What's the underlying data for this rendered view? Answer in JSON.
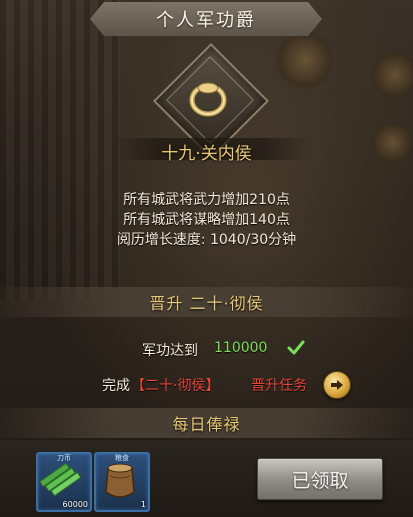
{
  "header": {
    "title": "个人军功爵"
  },
  "rank": {
    "name": "十九·关内侯"
  },
  "bonuses": [
    "所有城武将武力增加210点",
    "所有城武将谋略增加140点",
    "阅历增长速度: 1040/30分钟"
  ],
  "promotion": {
    "header": "晋升 二十·彻侯",
    "merit_label": "军功达到",
    "merit_value": "110000",
    "task_prefix": "完成",
    "task_name": "【二十·彻侯】",
    "task_suffix": "晋升任务"
  },
  "daily": {
    "header": "每日俸禄",
    "items": [
      {
        "top_label": "刀币",
        "count": "60000",
        "icon": "coins-icon"
      },
      {
        "top_label": "粮食",
        "count": "1",
        "icon": "grain-sack-icon"
      }
    ],
    "claim_label": "已领取"
  },
  "colors": {
    "accent_gold": "#e9c977",
    "met_green": "#7ddc5b",
    "task_red": "#e8463a"
  }
}
